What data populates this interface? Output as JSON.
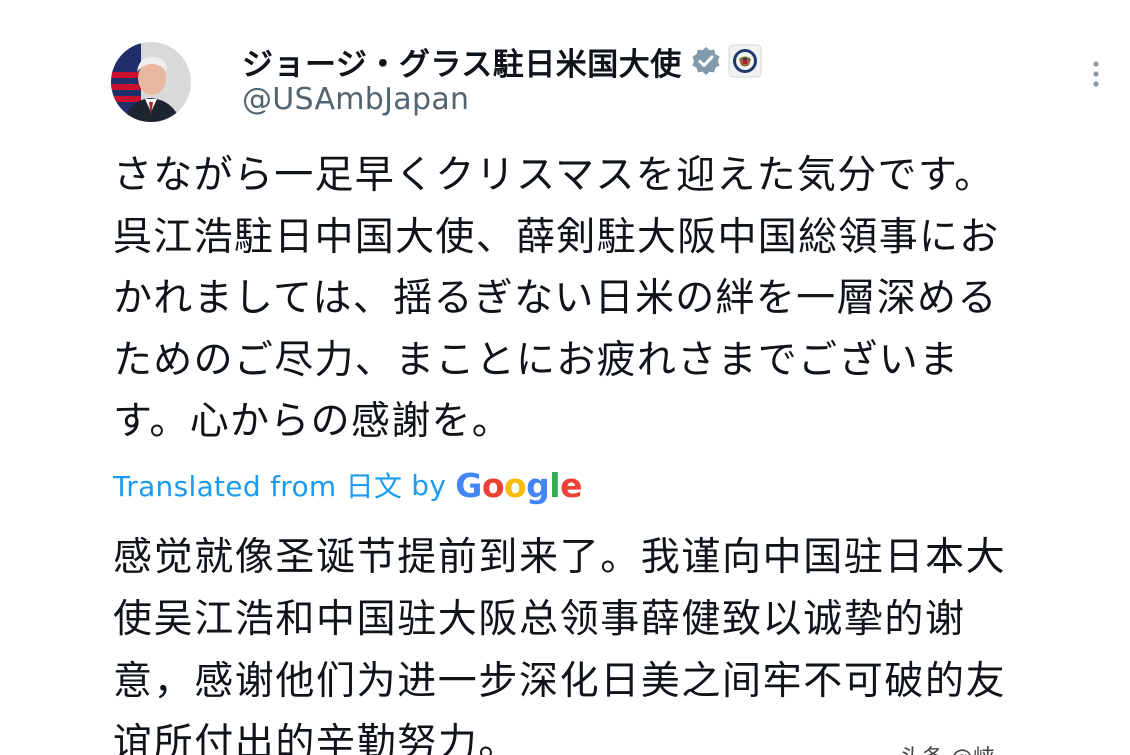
{
  "author": {
    "display_name": "ジョージ・グラス駐日米国大使",
    "handle": "@USAmbJapan",
    "avatar_icon": "profile-photo",
    "verified_icon": "verified-badge-icon",
    "affiliation_icon": "department-of-state-seal-icon"
  },
  "tweet": {
    "text_lines": [
      "さながら一足早くクリスマスを迎えた気分です。",
      "呉江浩駐日中国大使、薛剣駐大阪中国総領事にお",
      "かれましては、揺るぎない日米の絆を一層深める",
      "ためのご尽力、まことにお疲れさまでございま",
      "す。心からの感謝を。"
    ]
  },
  "translation": {
    "translated_from": "Translated from 日文",
    "by": "by",
    "provider": "Google",
    "provider_colors": [
      "#4285F4",
      "#EA4335",
      "#FBBC05",
      "#4285F4",
      "#34A853",
      "#EA4335"
    ],
    "text_lines": [
      "感觉就像圣诞节提前到来了。我谨向中国驻日本大",
      "使吴江浩和中国驻大阪总领事薛健致以诚挚的谢",
      "意，感谢他们为进一步深化日美之间牢不可破的友",
      "谊所付出的辛勤努力。"
    ]
  },
  "watermark": {
    "text": "头条 @峡…"
  },
  "colors": {
    "link": "#1d9bf0",
    "secondary_text": "#536471",
    "primary_text": "#0f1419",
    "verified_badge": "#829aab"
  }
}
